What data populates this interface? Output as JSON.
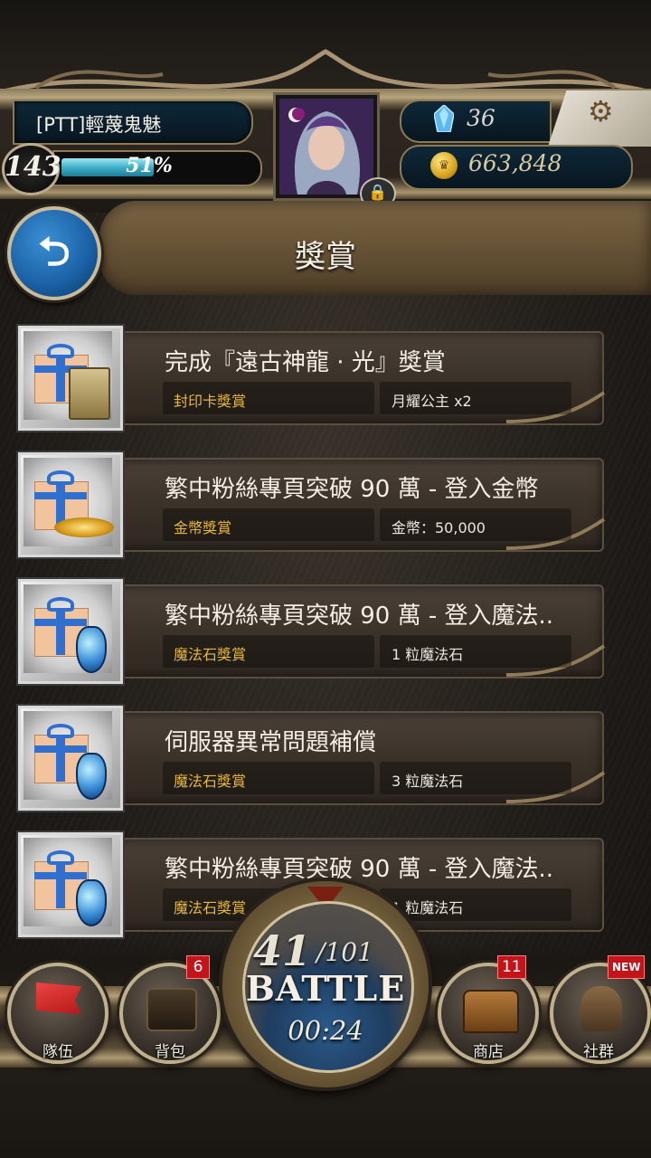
{
  "player": {
    "name": "[PTT]輕蔑鬼魅",
    "level": "143",
    "exp_percent_label": "51%",
    "exp_fraction": 0.51
  },
  "currency": {
    "gems": "36",
    "coins": "663,848"
  },
  "page": {
    "title": "獎賞"
  },
  "rewards": [
    {
      "title": "完成『遠古神龍 · 光』獎賞",
      "category": "封印卡獎賞",
      "content": "月耀公主 x2",
      "icon": "gift-with-card-icon"
    },
    {
      "title": "繁中粉絲專頁突破 90 萬 - 登入金幣",
      "category": "金幣獎賞",
      "content": "金幣：50,000",
      "icon": "gift-with-coins-icon"
    },
    {
      "title": "繁中粉絲專頁突破 90 萬 - 登入魔法..",
      "category": "魔法石獎賞",
      "content": "1 粒魔法石",
      "icon": "gift-with-magic-stone-icon"
    },
    {
      "title": "伺服器異常問題補償",
      "category": "魔法石獎賞",
      "content": "3 粒魔法石",
      "icon": "gift-with-magic-stone-icon"
    },
    {
      "title": "繁中粉絲專頁突破 90 萬 - 登入魔法..",
      "category": "魔法石獎賞",
      "content": "1 粒魔法石",
      "icon": "gift-with-magic-stone-icon"
    }
  ],
  "nav": {
    "team": {
      "label": "隊伍"
    },
    "bag": {
      "label": "背包",
      "badge": "6"
    },
    "shop": {
      "label": "商店",
      "badge": "11"
    },
    "social": {
      "label": "社群",
      "badge": "NEW"
    }
  },
  "battle": {
    "stamina_current": "41",
    "stamina_max": "/101",
    "label": "BATTLE",
    "timer": "00:24"
  },
  "colors": {
    "category_text": "#e6b93e",
    "exp_bar": "#3fb0c8",
    "badge": "#c4141a",
    "back_button": "#1a5fa3"
  }
}
